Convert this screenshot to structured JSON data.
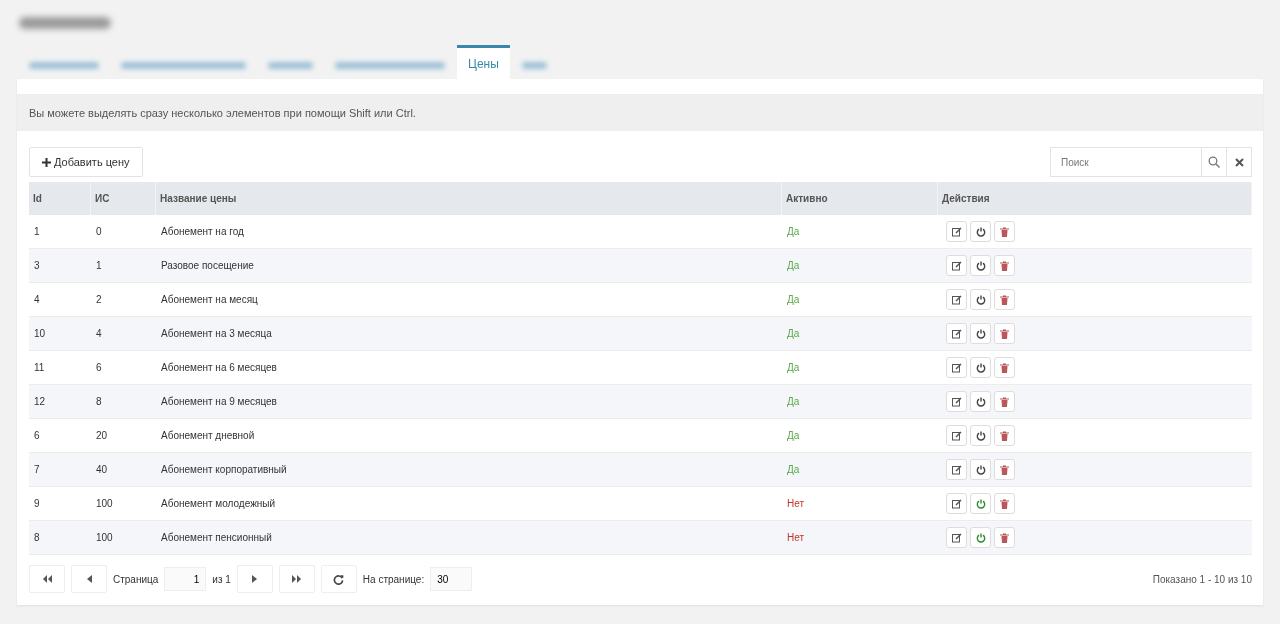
{
  "header": {
    "title": {
      "blurred": true
    }
  },
  "tabs": [
    {
      "kind": "blurred",
      "selected": false
    },
    {
      "kind": "blurred",
      "selected": false
    },
    {
      "kind": "blurred",
      "selected": false
    },
    {
      "kind": "blurred",
      "selected": false
    },
    {
      "kind": "text",
      "label": "Цены",
      "selected": true
    },
    {
      "kind": "blurred",
      "selected": false
    }
  ],
  "info": "Вы можете выделять сразу несколько элементов при помощи Shift или Ctrl.",
  "toolbar": {
    "add_button": "Добавить цену",
    "search": {
      "placeholder": "Поиск"
    }
  },
  "table": {
    "columns": [
      "Id",
      "ИС",
      "Название цены",
      "Активно",
      "Действия"
    ],
    "rows": [
      {
        "id": "1",
        "is": "0",
        "name": "Абонемент на год",
        "active": true,
        "active_label": "Да"
      },
      {
        "id": "3",
        "is": "1",
        "name": "Разовое посещение",
        "active": true,
        "active_label": "Да"
      },
      {
        "id": "4",
        "is": "2",
        "name": "Абонемент на месяц",
        "active": true,
        "active_label": "Да"
      },
      {
        "id": "10",
        "is": "4",
        "name": "Абонемент на 3 месяца",
        "active": true,
        "active_label": "Да"
      },
      {
        "id": "11",
        "is": "6",
        "name": "Абонемент на 6 месяцев",
        "active": true,
        "active_label": "Да"
      },
      {
        "id": "12",
        "is": "8",
        "name": "Абонемент на 9 месяцев",
        "active": true,
        "active_label": "Да"
      },
      {
        "id": "6",
        "is": "20",
        "name": "Абонемент дневной",
        "active": true,
        "active_label": "Да"
      },
      {
        "id": "7",
        "is": "40",
        "name": "Абонемент корпоративный",
        "active": true,
        "active_label": "Да"
      },
      {
        "id": "9",
        "is": "100",
        "name": "Абонемент молодежный",
        "active": false,
        "active_label": "Нет"
      },
      {
        "id": "8",
        "is": "100",
        "name": "Абонемент пенсионный",
        "active": false,
        "active_label": "Нет"
      }
    ]
  },
  "pager": {
    "page_label": "Страница",
    "page": "1",
    "of": "из 1",
    "per_page_label": "На странице:",
    "per_page": "30",
    "summary": "Показано 1 - 10 из 10"
  }
}
